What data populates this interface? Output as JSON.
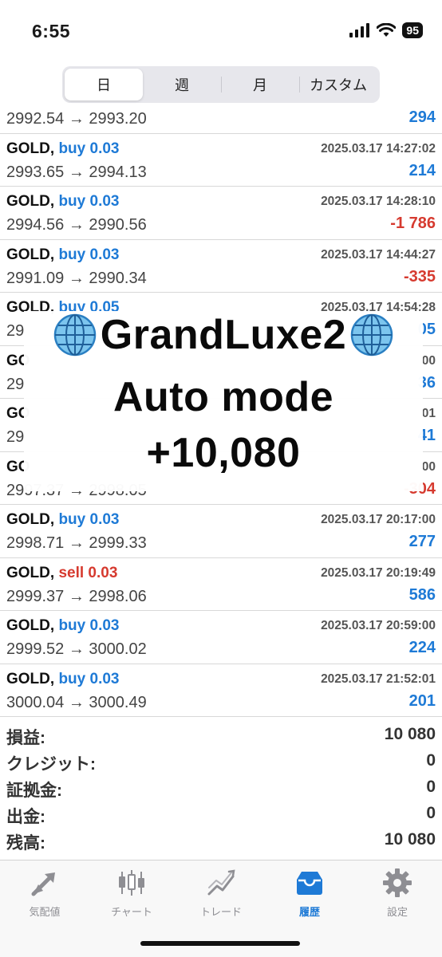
{
  "status_bar": {
    "time": "6:55",
    "battery": "95"
  },
  "segments": [
    {
      "label": "日",
      "active": true
    },
    {
      "label": "週",
      "active": false
    },
    {
      "label": "月",
      "active": false
    },
    {
      "label": "カスタム",
      "active": false
    }
  ],
  "trades": [
    {
      "symbol": "GOLD,",
      "side": "buy",
      "lots": "buy 0.03",
      "time": "",
      "prices": "2992.54 → 2993.20",
      "profit": "294"
    },
    {
      "symbol": "GOLD,",
      "side": "buy",
      "lots": "buy 0.03",
      "time": "2025.03.17 14:27:02",
      "prices": "2993.65 → 2994.13",
      "profit": "214"
    },
    {
      "symbol": "GOLD,",
      "side": "buy",
      "lots": "buy 0.03",
      "time": "2025.03.17 14:28:10",
      "prices": "2994.56 → 2990.56",
      "profit": "-1 786"
    },
    {
      "symbol": "GOLD,",
      "side": "buy",
      "lots": "buy 0.03",
      "time": "2025.03.17 14:44:27",
      "prices": "2991.09 → 2990.34",
      "profit": "-335"
    },
    {
      "symbol": "GOLD,",
      "side": "buy",
      "lots": "buy 0.05",
      "time": "2025.03.17 14:54:28",
      "prices": "29",
      "profit": "05"
    },
    {
      "symbol": "GO",
      "side": "buy",
      "lots": "",
      "time": "00",
      "prices": "29",
      "profit": "36"
    },
    {
      "symbol": "GO",
      "side": "buy",
      "lots": "",
      "time": "01",
      "prices": "29",
      "profit": "41"
    },
    {
      "symbol": "GO",
      "side": "buy",
      "lots": "",
      "time": "00",
      "prices": "2997.37 → 2998.05",
      "profit": "-304"
    },
    {
      "symbol": "GOLD,",
      "side": "buy",
      "lots": "buy 0.03",
      "time": "2025.03.17 20:17:00",
      "prices": "2998.71 → 2999.33",
      "profit": "277"
    },
    {
      "symbol": "GOLD,",
      "side": "sell",
      "lots": "sell 0.03",
      "time": "2025.03.17 20:19:49",
      "prices": "2999.37 → 2998.06",
      "profit": "586"
    },
    {
      "symbol": "GOLD,",
      "side": "buy",
      "lots": "buy 0.03",
      "time": "2025.03.17 20:59:00",
      "prices": "2999.52 → 3000.02",
      "profit": "224"
    },
    {
      "symbol": "GOLD,",
      "side": "buy",
      "lots": "buy 0.03",
      "time": "2025.03.17 21:52:01",
      "prices": "3000.04 → 3000.49",
      "profit": "201"
    }
  ],
  "overlay": {
    "title": "GrandLuxe2",
    "mode": "Auto mode",
    "profit": "+10,080",
    "icon": "globe-icon"
  },
  "summary": [
    {
      "label": "損益:",
      "value": "10 080"
    },
    {
      "label": "クレジット:",
      "value": "0"
    },
    {
      "label": "証拠金:",
      "value": "0"
    },
    {
      "label": "出金:",
      "value": "0"
    },
    {
      "label": "残高:",
      "value": "10 080"
    }
  ],
  "tabs": [
    {
      "label": "気配値",
      "icon": "quotes-arrows-icon",
      "active": false
    },
    {
      "label": "チャート",
      "icon": "candlestick-icon",
      "active": false
    },
    {
      "label": "トレード",
      "icon": "trade-chart-icon",
      "active": false
    },
    {
      "label": "履歴",
      "icon": "history-inbox-icon",
      "active": true
    },
    {
      "label": "設定",
      "icon": "gear-icon",
      "active": false
    }
  ],
  "colors": {
    "buy": "#1e7ad6",
    "sell": "#d63a2f",
    "tab_active": "#1e7ad6",
    "tab_inactive": "#8e8e93"
  }
}
